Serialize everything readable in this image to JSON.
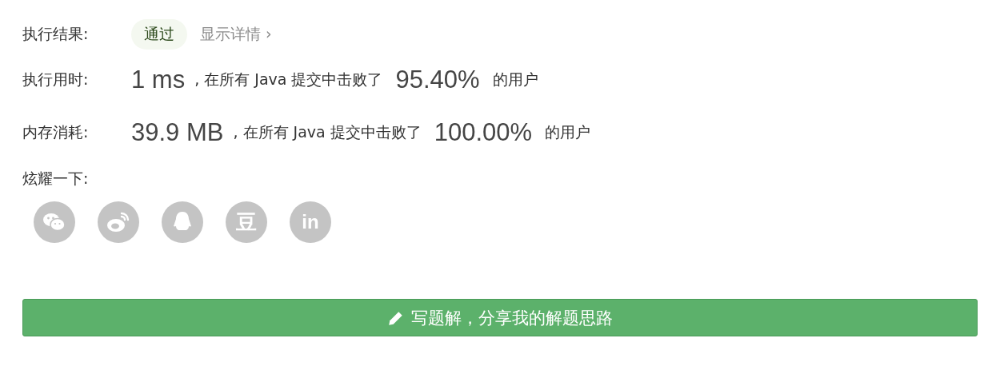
{
  "result": {
    "label": "执行结果:",
    "status": "通过",
    "details_link": "显示详情",
    "details_chevron": "›"
  },
  "stats": [
    {
      "label": "执行用时:",
      "value": "1 ms",
      "text": ", 在所有 Java 提交中击败了",
      "percent": "95.40%",
      "suffix": "的用户"
    },
    {
      "label": "内存消耗:",
      "value": "39.9 MB",
      "text": ", 在所有 Java 提交中击败了",
      "percent": "100.00%",
      "suffix": "的用户"
    }
  ],
  "share": {
    "label": "炫耀一下:",
    "icons": [
      {
        "kind": "wechat"
      },
      {
        "kind": "weibo"
      },
      {
        "kind": "qq"
      },
      {
        "kind": "douban",
        "glyph": "豆"
      },
      {
        "kind": "linkedin",
        "glyph": "in"
      }
    ]
  },
  "write_button": {
    "label": "写题解，分享我的解题思路"
  }
}
